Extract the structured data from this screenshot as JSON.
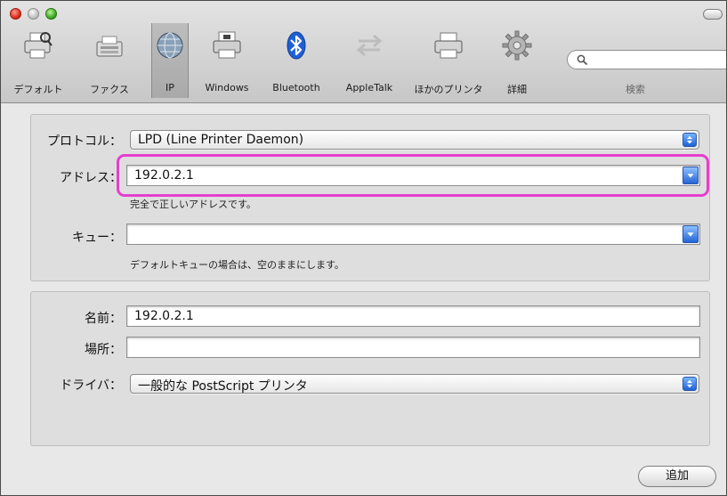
{
  "toolbar": {
    "items": [
      {
        "label": "デフォルト",
        "icon": "default-printer-icon"
      },
      {
        "label": "ファクス",
        "icon": "fax-icon"
      },
      {
        "label": "IP",
        "icon": "globe-icon"
      },
      {
        "label": "Windows",
        "icon": "windows-printer-icon"
      },
      {
        "label": "Bluetooth",
        "icon": "bluetooth-icon"
      },
      {
        "label": "AppleTalk",
        "icon": "appletalk-icon"
      },
      {
        "label": "ほかのプリンタ",
        "icon": "other-printer-icon"
      },
      {
        "label": "詳細",
        "icon": "gear-icon"
      }
    ],
    "search_label": "検索",
    "search_value": ""
  },
  "form": {
    "protocol_label": "プロトコル：",
    "protocol_value": "LPD (Line Printer Daemon)",
    "address_label": "アドレス：",
    "address_value": "192.0.2.1",
    "address_hint": "完全で正しいアドレスです。",
    "queue_label": "キュー：",
    "queue_value": "",
    "queue_hint": "デフォルトキューの場合は、空のままにします。"
  },
  "details": {
    "name_label": "名前：",
    "name_value": "192.0.2.1",
    "location_label": "場所：",
    "location_value": "",
    "driver_label": "ドライバ：",
    "driver_value": "一般的な PostScript プリンタ"
  },
  "actions": {
    "add_label": "追加"
  },
  "colors": {
    "highlight": "#e63ecf",
    "accent": "#2566d6"
  }
}
